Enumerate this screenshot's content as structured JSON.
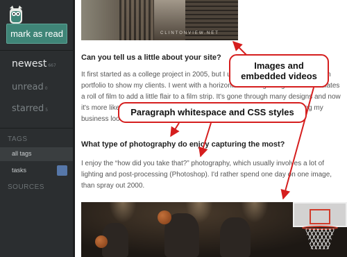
{
  "sidebar": {
    "logo_icon": "owl-icon",
    "mark_read_label": "mark as read",
    "nav": [
      {
        "label": "newest",
        "count": "667"
      },
      {
        "label": "unread",
        "count": "0"
      },
      {
        "label": "starred",
        "count": "5"
      }
    ],
    "tags_heading": "TAGS",
    "tags": [
      {
        "label": "all tags"
      },
      {
        "label": "tasks",
        "color": "#5677a9"
      }
    ],
    "sources_heading": "SOURCES"
  },
  "article": {
    "image1_caption": "CLINTONVIEW.NET",
    "heading1": "Can you tell us a little about your site?",
    "para1": "It first started as a college project in 2005, but I used it as my photography/design portfolio to show my clients. I went with a horizontal scrolling design which simulates a roll of film to add a little flair to a film strip. It's gone through many designs and now it's more like a blog, most of web design/coding goes a long way in keeping my business looking up to date.",
    "heading2": "What type of photography do enjoy capturing the most?",
    "para2": "I enjoy the “how did you take that?” photography, which usually involves a lot of lighting and post-processing (Photoshop). I'd rather spend one day on one image, than spray out 2000."
  },
  "annotations": {
    "callout1": "Images and embedded videos",
    "callout2": "Paragraph whitespace and CSS styles",
    "color": "#d51e1e"
  }
}
